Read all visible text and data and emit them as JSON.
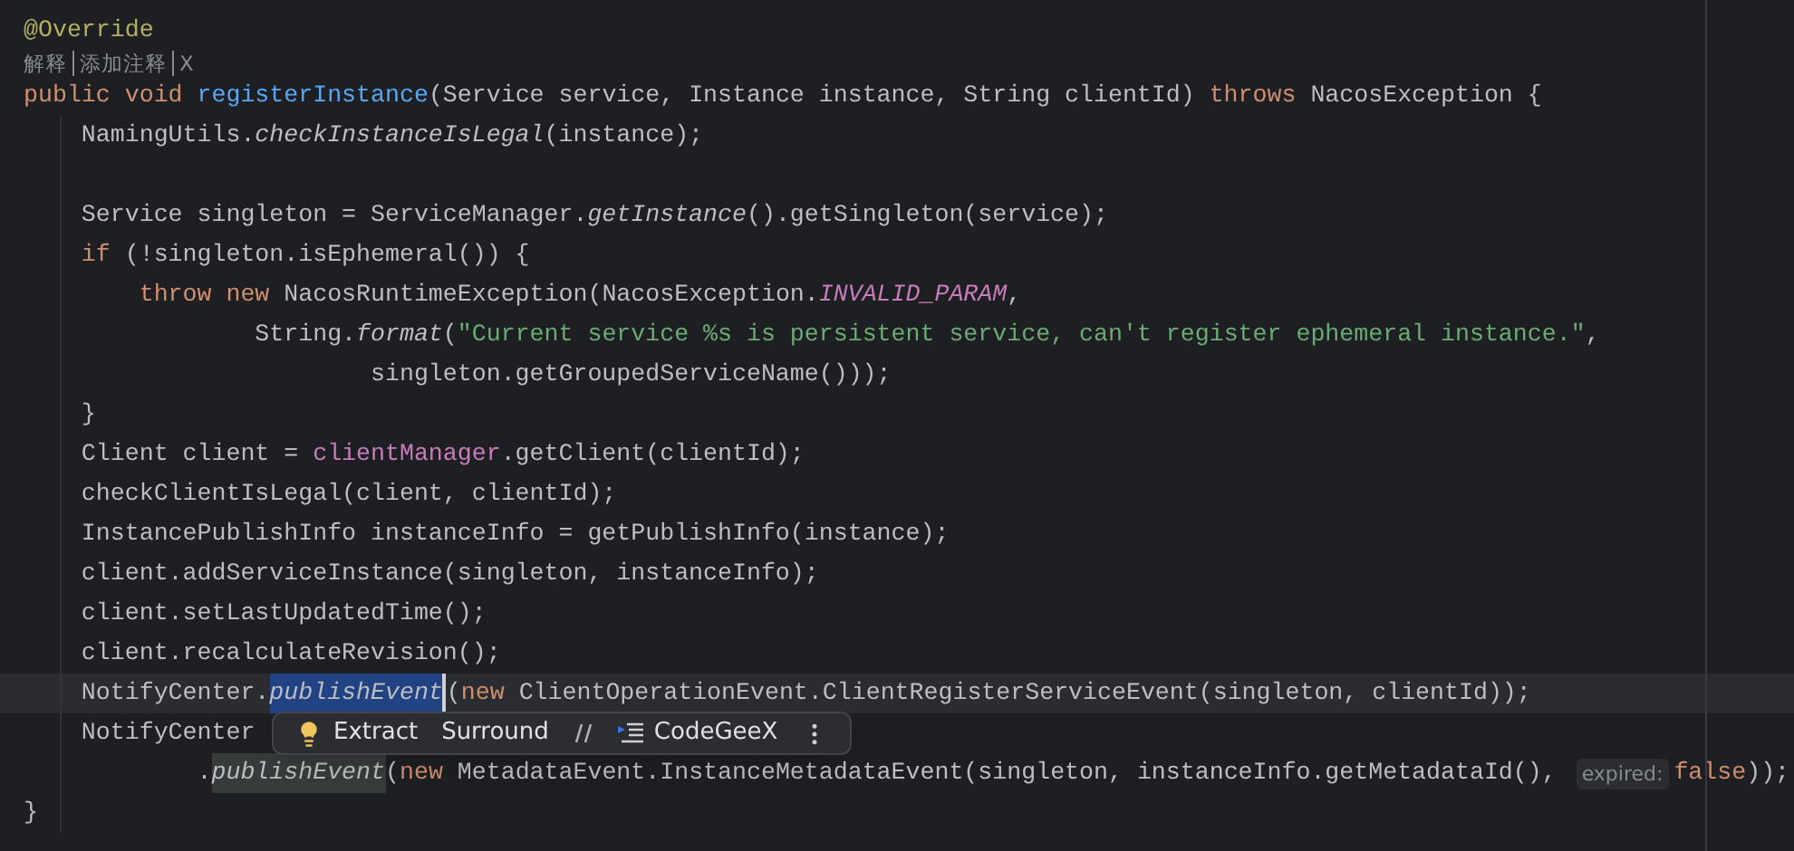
{
  "editor": {
    "lines": [
      {
        "kind": "code",
        "current": false,
        "tokens": [
          {
            "text": "@Override",
            "kind": "annotation"
          }
        ]
      },
      {
        "kind": "codelens",
        "items": [
          "解释",
          "添加注释",
          "X"
        ]
      },
      {
        "kind": "code",
        "current": false,
        "tokens": [
          {
            "text": "public void ",
            "kind": "keyword"
          },
          {
            "text": "registerInstance",
            "kind": "declaration"
          },
          {
            "text": "(Service service, Instance instance, String clientId) ",
            "kind": "plain"
          },
          {
            "text": "throws ",
            "kind": "keyword"
          },
          {
            "text": "NacosException {",
            "kind": "plain"
          }
        ]
      },
      {
        "kind": "code",
        "current": false,
        "tokens": [
          {
            "text": "    NamingUtils.",
            "kind": "plain"
          },
          {
            "text": "checkInstanceIsLegal",
            "kind": "static"
          },
          {
            "text": "(instance);",
            "kind": "plain"
          }
        ]
      },
      {
        "kind": "code",
        "current": false
      },
      {
        "kind": "code",
        "current": false,
        "tokens": [
          {
            "text": "    Service singleton = ServiceManager.",
            "kind": "plain"
          },
          {
            "text": "getInstance",
            "kind": "static"
          },
          {
            "text": "().getSingleton(service);",
            "kind": "plain"
          }
        ]
      },
      {
        "kind": "code",
        "current": false,
        "tokens": [
          {
            "text": "    if ",
            "kind": "keyword"
          },
          {
            "text": "(!singleton.isEphemeral()) {",
            "kind": "plain"
          }
        ]
      },
      {
        "kind": "code",
        "current": false,
        "tokens": [
          {
            "text": "        throw new ",
            "kind": "keyword"
          },
          {
            "text": "NacosRuntimeException(NacosException.",
            "kind": "plain"
          },
          {
            "text": "INVALID_PARAM",
            "kind": "constant"
          },
          {
            "text": ",",
            "kind": "plain"
          }
        ]
      },
      {
        "kind": "code",
        "current": false,
        "tokens": [
          {
            "text": "                String.",
            "kind": "plain"
          },
          {
            "text": "format",
            "kind": "static"
          },
          {
            "text": "(",
            "kind": "plain"
          },
          {
            "text": "\"Current service %s is persistent service, can't register ephemeral instance.\"",
            "kind": "string"
          },
          {
            "text": ",",
            "kind": "plain"
          }
        ]
      },
      {
        "kind": "code",
        "current": false,
        "tokens": [
          {
            "text": "                        singleton.getGroupedServiceName()));",
            "kind": "plain"
          }
        ]
      },
      {
        "kind": "code",
        "current": false,
        "tokens": [
          {
            "text": "    }",
            "kind": "plain"
          }
        ]
      },
      {
        "kind": "code",
        "current": false,
        "tokens": [
          {
            "text": "    Client client = ",
            "kind": "plain"
          },
          {
            "text": "clientManager",
            "kind": "field"
          },
          {
            "text": ".getClient(clientId);",
            "kind": "plain"
          }
        ]
      },
      {
        "kind": "code",
        "current": false,
        "tokens": [
          {
            "text": "    checkClientIsLegal(client, clientId);",
            "kind": "plain"
          }
        ]
      },
      {
        "kind": "code",
        "current": false,
        "tokens": [
          {
            "text": "    InstancePublishInfo instanceInfo = getPublishInfo(instance);",
            "kind": "plain"
          }
        ]
      },
      {
        "kind": "code",
        "current": false,
        "tokens": [
          {
            "text": "    client.addServiceInstance(singleton, instanceInfo);",
            "kind": "plain"
          }
        ]
      },
      {
        "kind": "code",
        "current": false,
        "tokens": [
          {
            "text": "    client.setLastUpdatedTime();",
            "kind": "plain"
          }
        ]
      },
      {
        "kind": "code",
        "current": false,
        "tokens": [
          {
            "text": "    client.recalculateRevision();",
            "kind": "plain"
          }
        ]
      },
      {
        "kind": "code",
        "current": true,
        "tokens": [
          {
            "text": "    NotifyCenter.",
            "kind": "plain"
          },
          {
            "text": "publishEvent",
            "kind": "selection"
          },
          {
            "text": "(",
            "kind": "plain"
          },
          {
            "text": "new ",
            "kind": "keyword"
          },
          {
            "text": "ClientOperationEvent.ClientRegisterServiceEvent(singleton, clientId));",
            "kind": "plain"
          }
        ]
      },
      {
        "kind": "code",
        "current": false,
        "tokens": [
          {
            "text": "    NotifyCenter",
            "kind": "plain"
          }
        ]
      },
      {
        "kind": "code",
        "current": false,
        "tokens": [
          {
            "text": "            .",
            "kind": "plain"
          },
          {
            "text": "publishEvent",
            "kind": "usage"
          },
          {
            "text": "(",
            "kind": "plain"
          },
          {
            "text": "new ",
            "kind": "keyword"
          },
          {
            "text": "MetadataEvent.InstanceMetadataEvent(singleton, instanceInfo.getMetadataId(), ",
            "kind": "plain"
          },
          {
            "text": "expired:",
            "kind": "hint"
          },
          {
            "text": "false",
            "kind": "keyword"
          },
          {
            "text": "));",
            "kind": "plain"
          }
        ]
      },
      {
        "kind": "code",
        "current": false,
        "tokens": [
          {
            "text": "}",
            "kind": "plain"
          }
        ]
      }
    ]
  },
  "popup": {
    "items": [
      {
        "kind": "bulb",
        "label": "Extract"
      },
      {
        "kind": "text",
        "label": "Surround"
      },
      {
        "kind": "comment"
      },
      {
        "kind": "ai",
        "label": "CodeGeeX"
      },
      {
        "kind": "more"
      }
    ]
  }
}
